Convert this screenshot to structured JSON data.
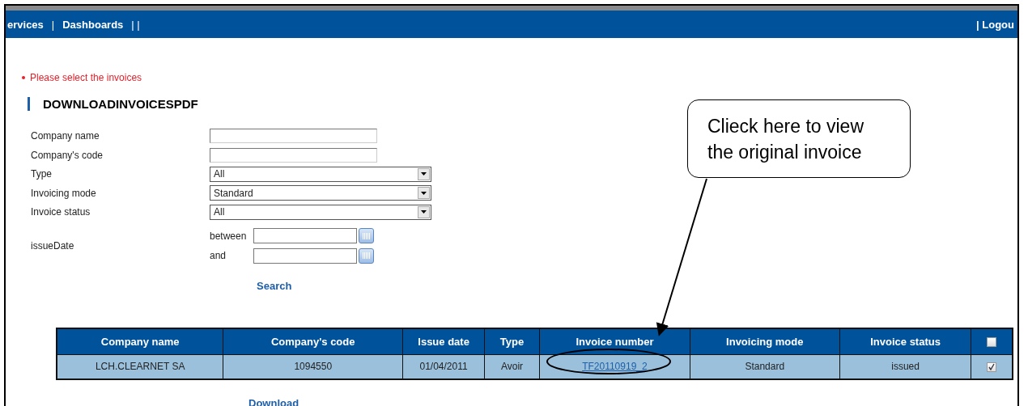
{
  "nav": {
    "items": [
      {
        "kind": "link",
        "label": "ervices"
      },
      {
        "kind": "separator",
        "label": "|"
      },
      {
        "kind": "link",
        "label": "Dashboards"
      },
      {
        "kind": "separator",
        "label": "| |"
      }
    ],
    "logout": "| Logou"
  },
  "error": {
    "message": "Please select the invoices"
  },
  "title": "DOWNLOADINVOICESPDF",
  "form": {
    "fields": [
      {
        "label": "Company name",
        "kind": "text"
      },
      {
        "label": "Company's code",
        "kind": "text"
      },
      {
        "label": "Type",
        "kind": "select",
        "value": "All"
      },
      {
        "label": "Invoicing mode",
        "kind": "select",
        "value": "Standard"
      },
      {
        "label": "Invoice status",
        "kind": "select",
        "value": "All"
      }
    ],
    "date": {
      "label": "issueDate",
      "from_label": "between",
      "to_label": "and"
    },
    "search": "Search"
  },
  "table": {
    "columns": [
      "Company name",
      "Company's code",
      "Issue date",
      "Type",
      "Invoice number",
      "Invoicing mode",
      "Invoice status"
    ],
    "select_all": {
      "checked": false
    },
    "rows": [
      {
        "cells": [
          "LCH.CLEARNET SA",
          "1094550",
          "01/04/2011",
          "Avoir",
          "TF20110919_2",
          "Standard",
          "issued"
        ],
        "checked": true
      }
    ]
  },
  "download": "Download",
  "callout": {
    "text": "Clieck here to view the original invoice"
  }
}
